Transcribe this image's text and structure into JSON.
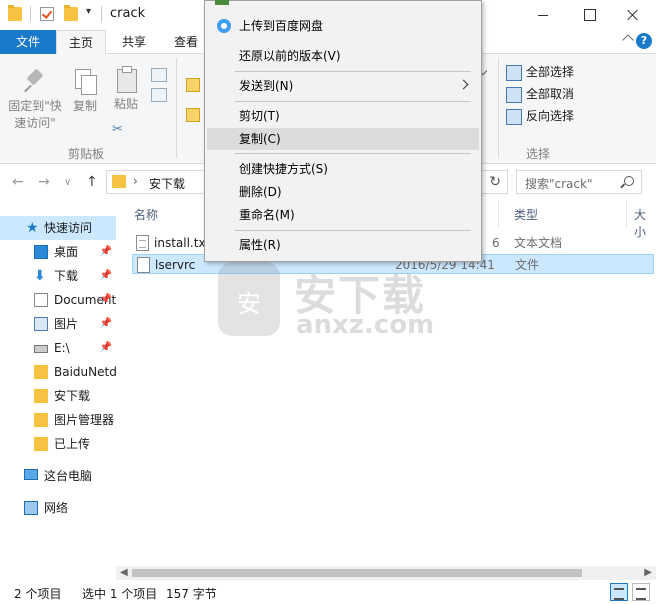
{
  "window": {
    "title": "crack",
    "quick_access_dropdown": "▾"
  },
  "ribbon": {
    "tabs": [
      "文件",
      "主页",
      "共享",
      "查看"
    ],
    "clipboard": {
      "pin_label_line1": "固定到\"快",
      "pin_label_line2": "速访问\"",
      "copy_label": "复制",
      "paste_label": "粘贴",
      "group_label": "剪贴板"
    },
    "select": {
      "select_all": "全部选择",
      "select_none": "全部取消",
      "invert": "反向选择",
      "group_label": "选择"
    }
  },
  "address": {
    "crumb": "安下载",
    "crumb_arrow": "›",
    "search_placeholder": "搜索\"crack\""
  },
  "nav": {
    "items": [
      {
        "label": "快速访问",
        "icon": "star-icon"
      },
      {
        "label": "桌面",
        "icon": "desktop-icon",
        "pinned": true
      },
      {
        "label": "下载",
        "icon": "download-icon",
        "pinned": true
      },
      {
        "label": "Documents",
        "icon": "document-icon",
        "pinned": true
      },
      {
        "label": "图片",
        "icon": "pictures-icon",
        "pinned": true
      },
      {
        "label": "E:\\",
        "icon": "drive-icon",
        "pinned": true
      },
      {
        "label": "BaiduNetdisk",
        "icon": "folder-icon"
      },
      {
        "label": "安下载",
        "icon": "folder-icon"
      },
      {
        "label": "图片管理器",
        "icon": "folder-icon"
      },
      {
        "label": "已上传",
        "icon": "folder-icon"
      },
      {
        "label": "这台电脑",
        "icon": "computer-icon"
      },
      {
        "label": "网络",
        "icon": "network-icon"
      }
    ]
  },
  "content": {
    "columns": {
      "name": "名称",
      "type": "类型",
      "size": "大小"
    },
    "files": [
      {
        "name": "install.txt",
        "date": "6",
        "type": "文本文档"
      },
      {
        "name": "lservrc",
        "date": "2016/5/29 14:41",
        "type": "文件"
      }
    ]
  },
  "watermark": {
    "cn": "安下载",
    "en": "anxz.com",
    "shield_char": "安"
  },
  "status": {
    "count": "2 个项目",
    "selected": "选中 1 个项目",
    "size": "157 字节"
  },
  "context_menu": {
    "items": [
      {
        "label": "上传到百度网盘"
      },
      {
        "label": "还原以前的版本(V)"
      },
      {
        "label": "发送到(N)",
        "submenu": true
      },
      {
        "label": "剪切(T)"
      },
      {
        "label": "复制(C)",
        "highlighted": true
      },
      {
        "label": "创建快捷方式(S)"
      },
      {
        "label": "删除(D)"
      },
      {
        "label": "重命名(M)"
      },
      {
        "label": "属性(R)"
      }
    ]
  },
  "colors": {
    "accent": "#1979ca",
    "selection": "#cce8ff"
  }
}
